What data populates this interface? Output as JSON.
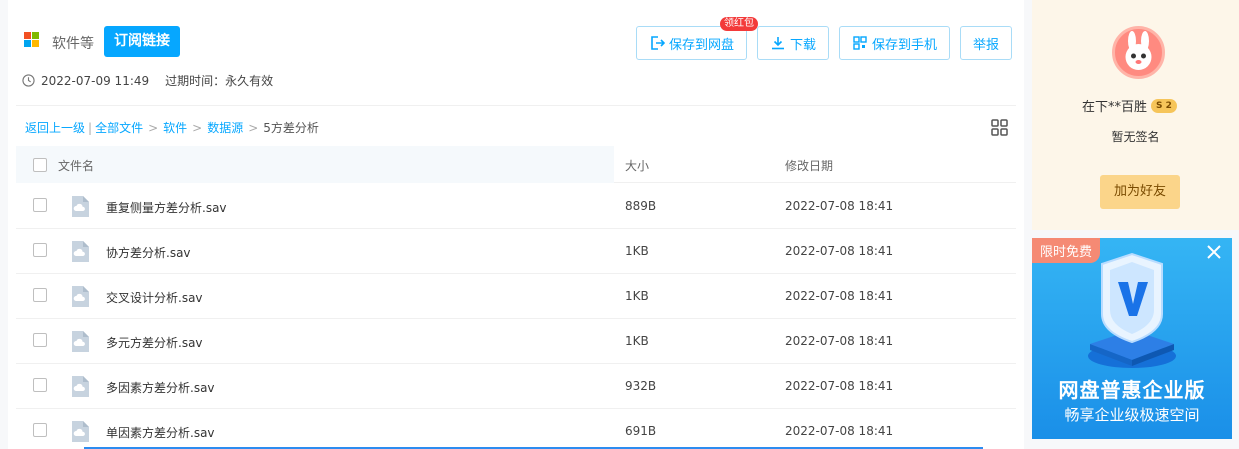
{
  "header": {
    "share_name": "软件等",
    "subscribe_label": "订阅链接",
    "save_to_disk_label": "保存到网盘",
    "red_packet_badge": "领红包",
    "download_label": "下载",
    "save_to_phone_label": "保存到手机",
    "report_label": "举报",
    "created_time": "2022-07-09 11:49",
    "expire_label": "过期时间：",
    "expire_value": "永久有效"
  },
  "breadcrumb": {
    "back": "返回上一级",
    "pipe": "|",
    "all_files": "全部文件",
    "software": "软件",
    "data_source": "数据源",
    "current": "5方差分析",
    "separator": ">"
  },
  "table": {
    "col_name": "文件名",
    "col_size": "大小",
    "col_date": "修改日期",
    "rows": [
      {
        "name": "重复侧量方差分析.sav",
        "size": "889B",
        "date": "2022-07-08 18:41"
      },
      {
        "name": "协方差分析.sav",
        "size": "1KB",
        "date": "2022-07-08 18:41"
      },
      {
        "name": "交叉设计分析.sav",
        "size": "1KB",
        "date": "2022-07-08 18:41"
      },
      {
        "name": "多元方差分析.sav",
        "size": "1KB",
        "date": "2022-07-08 18:41"
      },
      {
        "name": "多因素方差分析.sav",
        "size": "932B",
        "date": "2022-07-08 18:41"
      },
      {
        "name": "单因素方差分析.sav",
        "size": "691B",
        "date": "2022-07-08 18:41"
      }
    ]
  },
  "sidebar": {
    "username": "在下**百胜",
    "level_badge": "S 2",
    "signature": "暂无签名",
    "add_friend_label": "加为好友"
  },
  "ad": {
    "tag": "限时免费",
    "title": "网盘普惠企业版",
    "subtitle": "畅享企业级极速空间"
  },
  "colors": {
    "accent": "#06a7ff",
    "badge_red": "#f33a3a",
    "friend_button": "#fbd58a"
  }
}
